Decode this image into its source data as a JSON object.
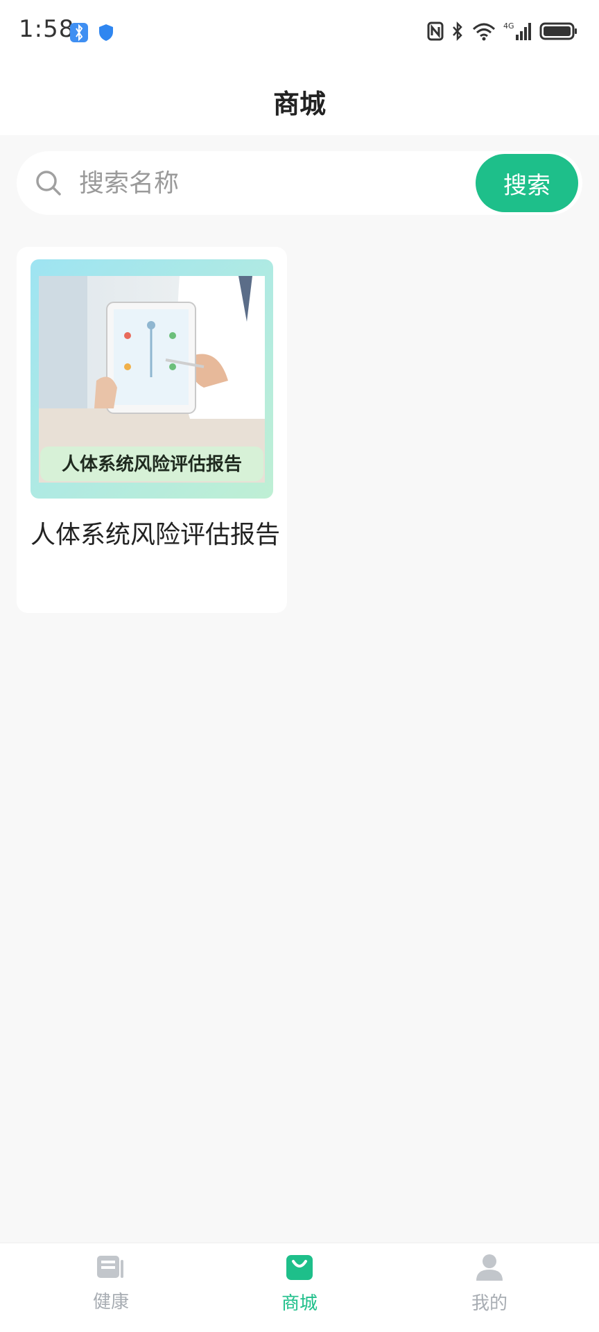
{
  "status_bar": {
    "time": "1:58",
    "network": "4G"
  },
  "header": {
    "title": "商城"
  },
  "search": {
    "placeholder": "搜索名称",
    "value": "",
    "button_label": "搜索"
  },
  "products": [
    {
      "image_banner_text": "人体系统风险评估报告",
      "name": "人体系统风险评估报告"
    }
  ],
  "tab_bar": {
    "items": [
      {
        "label": "健康",
        "icon": "news-icon",
        "active": false
      },
      {
        "label": "商城",
        "icon": "shopping-bag-icon",
        "active": true
      },
      {
        "label": "我的",
        "icon": "user-icon",
        "active": false
      }
    ]
  },
  "colors": {
    "accent": "#1ebf8a",
    "inactive_tab": "#a8adb3",
    "background": "#f8f8f8"
  }
}
